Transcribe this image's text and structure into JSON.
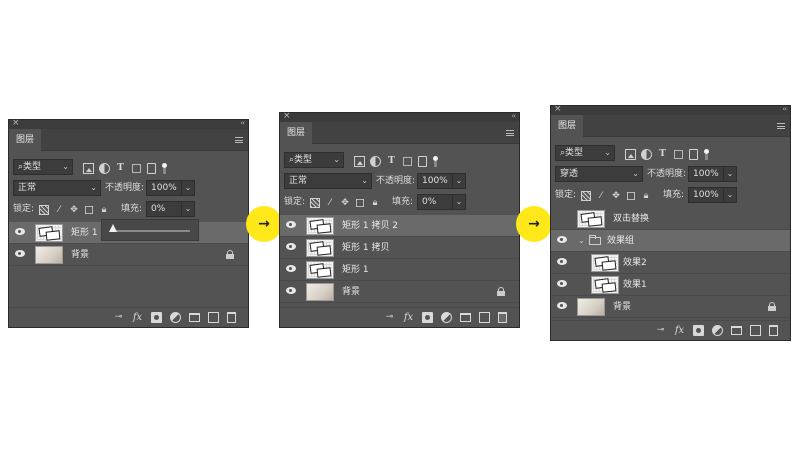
{
  "panel_tab": "图层",
  "filter_label": "类型",
  "opacity_label": "不透明度:",
  "lock_label": "锁定:",
  "fill_label": "填充:",
  "panel1": {
    "blend_mode": "正常",
    "opacity": "100%",
    "fill": "0%",
    "fill_slider_value": 0,
    "layers": [
      {
        "name": "矩形 1",
        "type": "shape",
        "selected": true
      },
      {
        "name": "背景",
        "type": "background",
        "locked": true
      }
    ]
  },
  "panel2": {
    "blend_mode": "正常",
    "opacity": "100%",
    "fill": "0%",
    "layers": [
      {
        "name": "矩形 1 拷贝 2",
        "type": "shape",
        "selected": true
      },
      {
        "name": "矩形 1 拷贝",
        "type": "shape"
      },
      {
        "name": "矩形 1",
        "type": "shape"
      },
      {
        "name": "背景",
        "type": "background",
        "locked": true
      }
    ]
  },
  "panel3": {
    "blend_mode": "穿透",
    "opacity": "100%",
    "fill": "100%",
    "layers": [
      {
        "name": "双击替换",
        "type": "shape",
        "visible": false
      },
      {
        "name": "效果组",
        "type": "group",
        "selected": true
      },
      {
        "name": "效果2",
        "type": "shape",
        "indent": true
      },
      {
        "name": "效果1",
        "type": "shape",
        "indent": true
      },
      {
        "name": "背景",
        "type": "background",
        "locked": true
      }
    ]
  },
  "arrow_glyph": "→",
  "icons": [
    "close-icon",
    "collapse-icon",
    "menu-icon",
    "search-icon",
    "image-filter-icon",
    "adjustment-filter-icon",
    "type-filter-icon",
    "shape-filter-icon",
    "smartobject-filter-icon",
    "filter-toggle-icon",
    "lock-transparent-icon",
    "lock-paint-icon",
    "lock-move-icon",
    "lock-artboard-icon",
    "lock-all-icon",
    "eye-icon",
    "lock-icon",
    "link-icon",
    "fx-icon",
    "mask-icon",
    "adjustment-icon",
    "folder-icon",
    "new-layer-icon",
    "trash-icon"
  ],
  "colors": {
    "panel": "#535353",
    "dark": "#3c3c3c",
    "selected_row": "#6a6a6a",
    "arrow_bg": "#ffe81a"
  }
}
